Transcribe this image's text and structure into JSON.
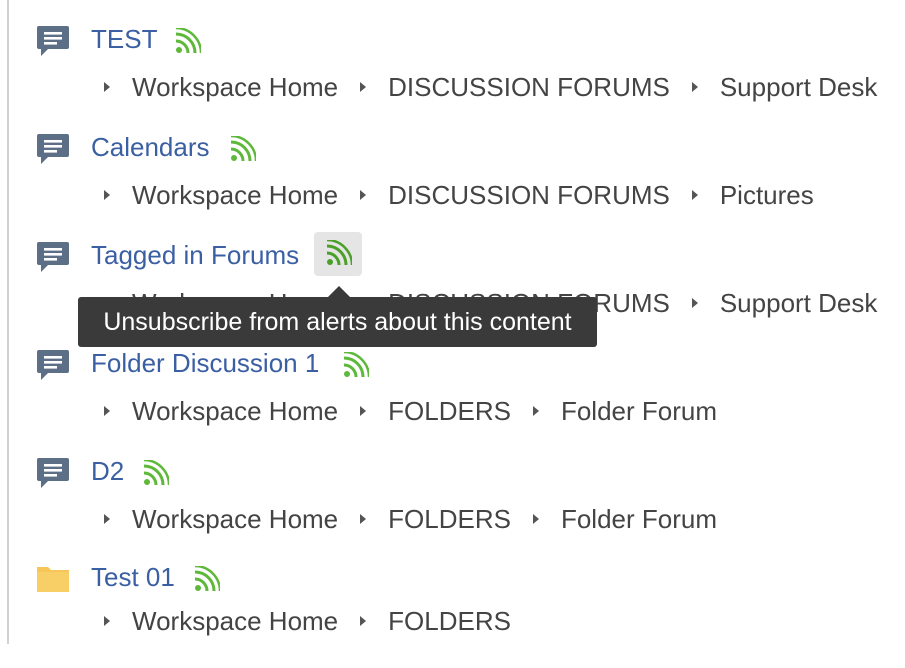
{
  "tooltip": {
    "text": "Unsubscribe from alerts about this content"
  },
  "items": [
    {
      "title": "TEST",
      "type_icon": "discussion-icon",
      "breadcrumbs": [
        "Workspace Home",
        "DISCUSSION FORUMS",
        "Support Desk"
      ]
    },
    {
      "title": "Calendars",
      "type_icon": "discussion-icon",
      "breadcrumbs": [
        "Workspace Home",
        "DISCUSSION FORUMS",
        "Pictures"
      ]
    },
    {
      "title": "Tagged in Forums",
      "type_icon": "discussion-icon",
      "rss_active": true,
      "breadcrumbs": [
        "Workspace Home",
        "DISCUSSION FORUMS",
        "Support Desk"
      ]
    },
    {
      "title": "Folder Discussion 1",
      "type_icon": "discussion-icon",
      "breadcrumbs": [
        "Workspace Home",
        "FOLDERS",
        "Folder Forum"
      ]
    },
    {
      "title": "D2",
      "type_icon": "discussion-icon",
      "breadcrumbs": [
        "Workspace Home",
        "FOLDERS",
        "Folder Forum"
      ]
    },
    {
      "title": "Test 01",
      "type_icon": "folder-icon",
      "breadcrumbs": [
        "Workspace Home",
        "FOLDERS"
      ]
    }
  ],
  "colors": {
    "link": "#3a5fa3",
    "rss": "#5eb83a",
    "discussion_icon": "#5c6f86",
    "folder_icon": "#f6c758",
    "tooltip_bg": "#3a3a3a"
  }
}
